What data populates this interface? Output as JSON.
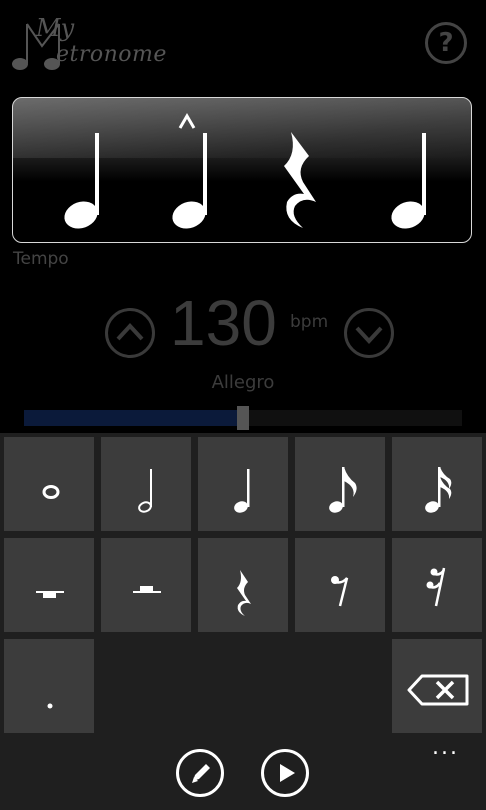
{
  "app": {
    "logo_small": "My",
    "logo_main": "etronome",
    "help_label": "?"
  },
  "staff": {
    "notes": [
      {
        "name": "quarter-note",
        "accent": false
      },
      {
        "name": "quarter-note",
        "accent": true
      },
      {
        "name": "quarter-rest",
        "accent": false
      },
      {
        "name": "quarter-note",
        "accent": false
      }
    ]
  },
  "tempo": {
    "label": "Tempo",
    "bpm": "130",
    "unit": "bpm",
    "name": "Allegro",
    "slider_fraction": 0.5
  },
  "keypad": {
    "rows": [
      [
        "whole-note",
        "half-note",
        "quarter-note",
        "eighth-note",
        "sixteenth-note"
      ],
      [
        "whole-rest",
        "half-rest",
        "quarter-rest",
        "eighth-rest",
        "sixteenth-rest"
      ],
      [
        "dot",
        "backspace-icon"
      ]
    ]
  },
  "appbar": {
    "buttons": [
      "edit-icon",
      "play-icon"
    ],
    "more_label": "..."
  },
  "colors": {
    "accent": "#0b1a3a",
    "tile": "#3c3c3c",
    "keypad_bg": "#1f1f1f"
  }
}
